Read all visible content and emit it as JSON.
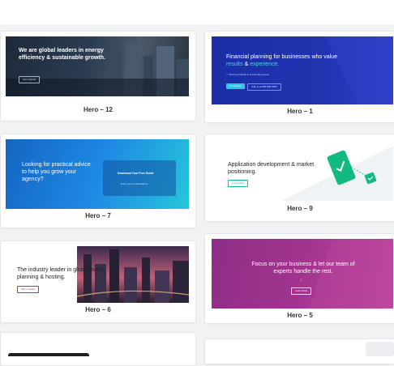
{
  "templates": [
    {
      "label": "Hero – 12",
      "headline": "We are global leaders in energy efficiency & sustainable growth.",
      "button": "Get a Quote"
    },
    {
      "label": "Hero – 1",
      "headline_a": "Financial planning for businesses who value ",
      "headline_b": "results",
      "headline_c": " & ",
      "headline_d": "experience.",
      "bullet": "Serving Orlando & surrounding areas",
      "button_primary": "Contact Us",
      "button_secondary": "Call us at 555 555 5555"
    },
    {
      "label": "Hero – 7",
      "headline": "Looking for practical advice to help you grow your agency?",
      "panel_title": "Download Your Free Guide",
      "panel_field": "Enter your email address"
    },
    {
      "label": "Hero – 9",
      "headline_a": "Application development ",
      "headline_b": "& market positioning.",
      "button": "Learn More"
    },
    {
      "label": "Hero – 6",
      "headline": "The industry leader in global event planning & hosting.",
      "button": "Talk to Sales"
    },
    {
      "label": "Hero – 5",
      "headline": "Focus on your business & let our team of experts handle the rest.",
      "button": "Learn More"
    }
  ],
  "colors": {
    "accent_teal": "#12b981",
    "deep_blue": "#1b2aa8",
    "sky_blue": "#1ea0df",
    "magenta": "#a2348f"
  }
}
